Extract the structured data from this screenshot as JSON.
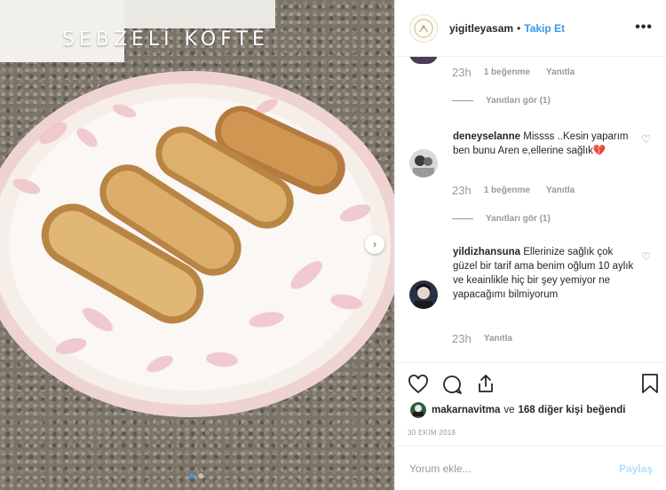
{
  "media": {
    "overlay_title": "SEBZELİ KÖFTE",
    "next_icon": "chevron-right-icon",
    "carousel_dots": 2,
    "active_dot": 0
  },
  "header": {
    "username": "yigitleyasam",
    "separator": "•",
    "follow_label": "Takip Et",
    "more_icon": "more-horizontal-icon",
    "more_label": "•••"
  },
  "comments": [
    {
      "time": "23h",
      "likes_label": "1 beğenme",
      "reply_label": "Yanıtla",
      "view_replies": "Yanıtları gör (1)"
    },
    {
      "username": "deneyselanne",
      "text": "Missss ..Kesin yaparım ben bunu Aren e,ellerine sağlık💔",
      "time": "23h",
      "likes_label": "1 beğenme",
      "reply_label": "Yanıtla",
      "view_replies": "Yanıtları gör (1)"
    },
    {
      "username": "yildizhansuna",
      "text": "Ellerinize sağlık çok güzel bir tarif ama benim oğlum 10 aylık ve keainlikle hiç bir şey yemiyor ne yapacağımı bilmiyorum",
      "time": "23h",
      "reply_label": "Yanıtla"
    }
  ],
  "actions": {
    "like_icon": "heart-icon",
    "comment_icon": "comment-icon",
    "share_icon": "share-icon",
    "save_icon": "bookmark-icon"
  },
  "likes": {
    "user": "makarnavitma",
    "connector": "ve",
    "others": "168 diğer kişi",
    "suffix": "beğendi"
  },
  "date": "30 EKİM 2018",
  "add_comment": {
    "placeholder": "Yorum ekle...",
    "post_label": "Paylaş"
  },
  "colors": {
    "accent": "#3897f0",
    "post_disabled": "#b2dffc",
    "muted": "#999999",
    "text": "#262626"
  }
}
